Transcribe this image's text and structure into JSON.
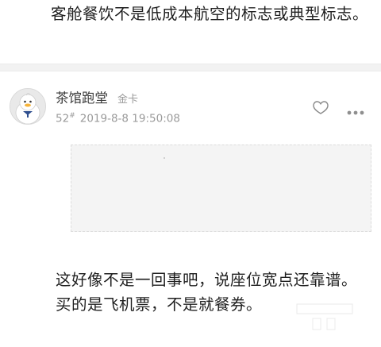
{
  "previous_post": {
    "text": "客舱餐饮不是低成本航空的标志或典型标志。"
  },
  "reply": {
    "username": "茶馆跑堂",
    "rank": "金卡",
    "floor": "52",
    "floor_suffix": "#",
    "datetime": "2019-8-8 19:50:08",
    "body_line1": "这好像不是一回事吧，说座位宽点还靠谱。",
    "body_line2": "买的是飞机票，不是就餐券。"
  },
  "icons": {
    "favorite": "star-outline-icon",
    "more": "more-horizontal-icon",
    "avatar": "duck-avatar"
  },
  "colors": {
    "text": "#1f1f1f",
    "meta": "#9a9a9a",
    "divider": "#f2f2f2",
    "placeholder": "#f4f4f4"
  }
}
